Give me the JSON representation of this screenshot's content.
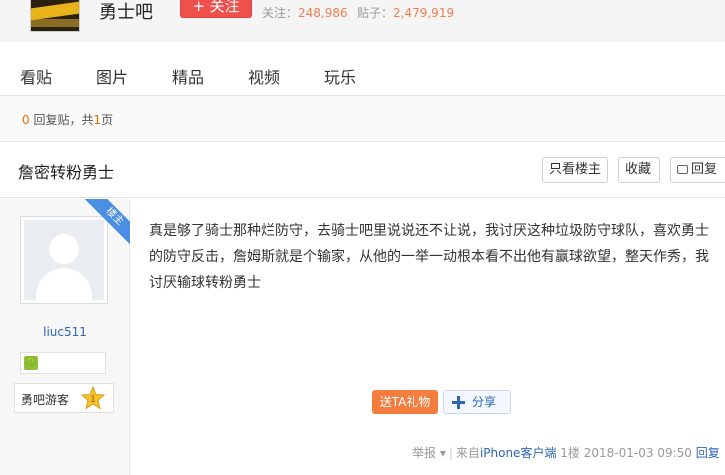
{
  "header": {
    "forum_name": "勇士吧",
    "follow_label": "+ 关注",
    "follow_count_label": "关注：",
    "follow_count": "248,986",
    "post_count_label": "贴子：",
    "post_count": "2,479,919"
  },
  "nav": {
    "items": [
      "看贴",
      "图片",
      "精品",
      "视频",
      "玩乐"
    ]
  },
  "page_info": {
    "reply_count": "0",
    "reply_text": " 回复贴，共",
    "page_count": "1",
    "page_suffix": "页"
  },
  "thread": {
    "title": "詹密转粉勇士",
    "only_op_label": "只看楼主",
    "favorite_label": "收藏",
    "reply_label": "回复"
  },
  "post": {
    "op_ribbon": "楼主",
    "author": "liuc511",
    "level_badge": "🍀",
    "badge_title": "勇吧游客",
    "badge_level": "1",
    "content": "真是够了骑士那种烂防守，去骑士吧里说说还不让说，我讨厌这种垃圾防守球队，喜欢勇士的防守反击，詹姆斯就是个输家，从他的一举一动根本看不出他有赢球欲望，整天作秀，我讨厌输球转粉勇士",
    "gift_label": "送TA礼物",
    "share_label": "分享",
    "report_label": "举报",
    "source_prefix": "来自",
    "source": "iPhone客户端",
    "floor": "1楼",
    "datetime": "2018-01-03 09:50",
    "reply_label": "回复"
  },
  "colors": {
    "accent_red": "#f0504b",
    "link_blue": "#2d64b3",
    "gift_orange": "#f47c3c",
    "ribbon_blue": "#4a8fe3"
  }
}
